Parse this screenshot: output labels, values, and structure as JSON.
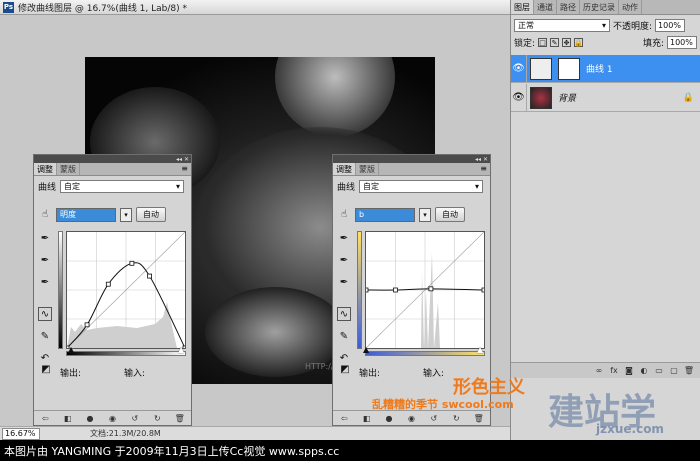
{
  "document": {
    "title": "修改曲线图层 @ 16.7%(曲线 1, Lab/8) *",
    "zoom": "16.67%",
    "info": "文档:21.3M/20.8M",
    "watermark_on_canvas": "HTTP://"
  },
  "layers_panel": {
    "tabs": [
      "图层",
      "通道",
      "路径",
      "历史记录",
      "动作"
    ],
    "blend_mode": "正常",
    "opacity_label": "不透明度:",
    "opacity_value": "100%",
    "lock_label": "锁定:",
    "fill_label": "填充:",
    "fill_value": "100%",
    "layers": [
      {
        "name": "曲线 1",
        "selected": true
      },
      {
        "name": "背景",
        "selected": false
      }
    ]
  },
  "curves_left": {
    "tabs": [
      "调整",
      "蒙版"
    ],
    "type_label": "曲线",
    "preset": "自定",
    "channel": "明度",
    "auto_button": "自动",
    "output_label": "输出:",
    "input_label": "输入:",
    "curve_points": [
      [
        0,
        0
      ],
      [
        0.17,
        0.2
      ],
      [
        0.35,
        0.55
      ],
      [
        0.55,
        0.73
      ],
      [
        0.7,
        0.62
      ],
      [
        1,
        0
      ]
    ]
  },
  "curves_right": {
    "tabs": [
      "调整",
      "蒙版"
    ],
    "type_label": "曲线",
    "preset": "自定",
    "channel": "b",
    "auto_button": "自动",
    "output_label": "输出:",
    "input_label": "输入:",
    "curve_points": [
      [
        0,
        0.5
      ],
      [
        0.25,
        0.5
      ],
      [
        0.55,
        0.51
      ],
      [
        1,
        0.5
      ]
    ]
  },
  "watermarks": {
    "brand": "形色主义",
    "sub": "乱糟糟的季节 swcool.com",
    "site_cn": "建站学",
    "site_url": "jzxue.com"
  },
  "caption": "本图片由 YANGMING 于2009年11月3日上传Cc视觉 www.spps.cc"
}
